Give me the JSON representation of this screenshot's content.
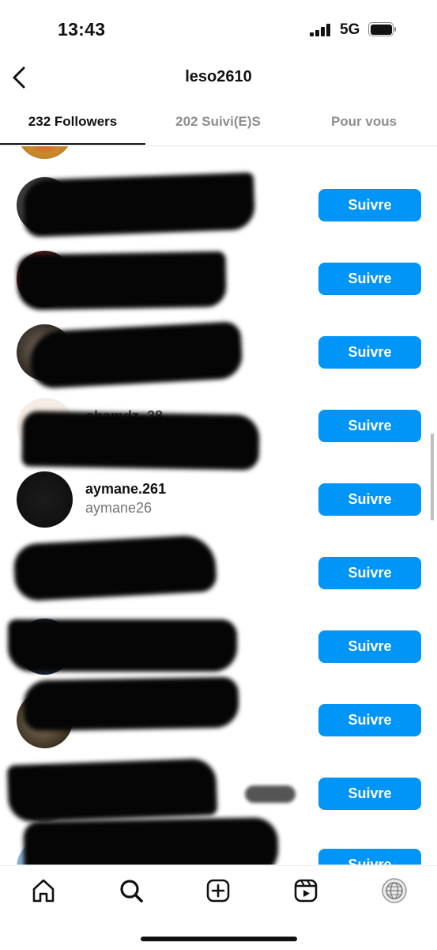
{
  "status_bar": {
    "time": "13:43",
    "network": "5G",
    "signal_icon": "cellular-signal-icon",
    "battery_icon": "battery-full-icon"
  },
  "header": {
    "title": "leso2610",
    "back_icon": "chevron-left-icon"
  },
  "tabs": [
    {
      "label": "232 Followers",
      "active": true
    },
    {
      "label": "202 Suivi(E)S",
      "active": false
    },
    {
      "label": "Pour vous",
      "active": false
    }
  ],
  "list": {
    "follow_label": "Suivre",
    "partial_top_label": "",
    "partial_bottom_label": "Suivre",
    "visible_user": {
      "username": "aymane.261",
      "fullname": "aymane26"
    },
    "partially_visible_text": "ohamdz_38"
  },
  "bottom_nav": [
    {
      "icon": "home-icon"
    },
    {
      "icon": "search-icon"
    },
    {
      "icon": "create-post-icon"
    },
    {
      "icon": "reels-icon"
    },
    {
      "icon": "profile-avatar-icon"
    }
  ],
  "colors": {
    "accent": "#0095f6",
    "text": "#111111",
    "secondary_text": "#737373"
  }
}
